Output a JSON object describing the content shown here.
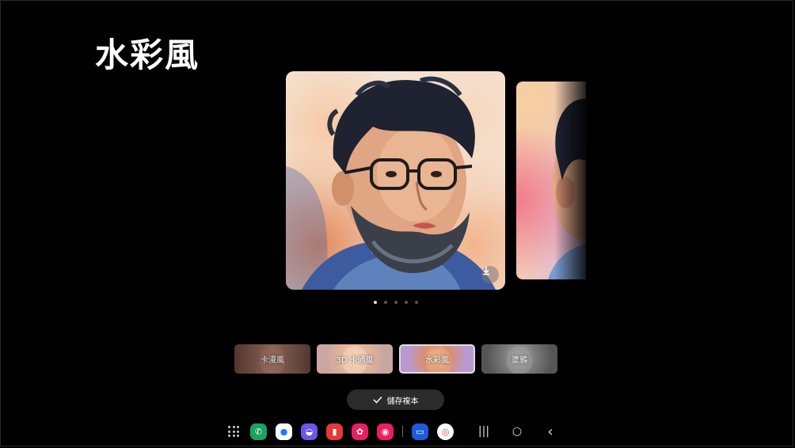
{
  "header": {
    "title": "水彩風"
  },
  "carousel": {
    "page_count": 5,
    "active_index": 0,
    "download_icon": "download-icon"
  },
  "styles": [
    {
      "label": "卡漫風",
      "selected": false
    },
    {
      "label": "3D 卡通風",
      "selected": false
    },
    {
      "label": "水彩風",
      "selected": true
    },
    {
      "label": "塗鴉",
      "selected": false
    }
  ],
  "actions": {
    "save_label": "儲存複本",
    "save_icon": "check-icon"
  },
  "taskbar": {
    "apps": [
      {
        "name": "phone-app",
        "color": "#1aa260",
        "glyph": "✆"
      },
      {
        "name": "messages-app",
        "color": "#1f7cff",
        "glyph": "●"
      },
      {
        "name": "internet-app",
        "color": "#6b58e8",
        "glyph": "◒"
      },
      {
        "name": "flipboard-app",
        "color": "#e53935",
        "glyph": "▮"
      },
      {
        "name": "blossom-app",
        "color": "#e91e63",
        "glyph": "✿"
      },
      {
        "name": "camera-app",
        "color": "#e91e63",
        "glyph": "◉"
      },
      {
        "name": "samsung-notes-app",
        "color": "#1e5bd8",
        "glyph": "▭"
      },
      {
        "name": "chrome-app",
        "color": "#ffffff",
        "glyph": "◎"
      }
    ],
    "nav": {
      "recents": "|||",
      "home": "○",
      "back": "‹"
    }
  }
}
